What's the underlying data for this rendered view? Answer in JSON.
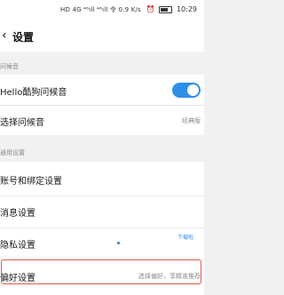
{
  "status_bar": {
    "left_text": "HD 4G ⁴⁶ıll ⁴⁶ıll 令 0.9 K/s",
    "right_text": "10:29"
  },
  "header": {
    "back_glyph": "‹",
    "title": "设置"
  },
  "sections": {
    "greeting_label": "问候音",
    "common_label": "通用设置"
  },
  "rows": {
    "hello_label": "Hello酷狗问候音",
    "choose_label": "选择问候音",
    "choose_value": "经典版",
    "account_label": "账号和绑定设置",
    "message_label": "消息设置",
    "privacy_label": "隐私设置",
    "preference_label": "偏好设置",
    "preference_value": "选择偏好，享精准推荐"
  },
  "hint": {
    "scroll_text": "下载啦"
  },
  "toggle": {
    "hello_enabled": true
  },
  "colors": {
    "accent": "#2f8fe8",
    "highlight": "#e05a4c"
  }
}
